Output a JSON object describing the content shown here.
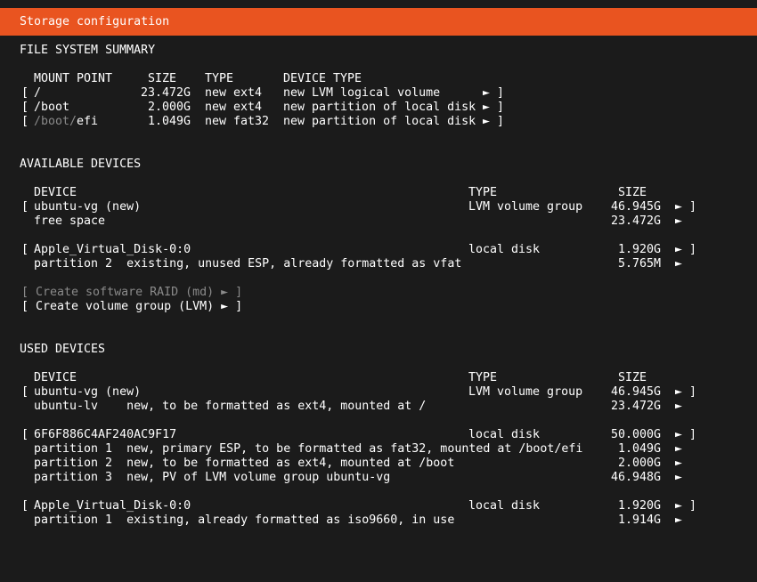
{
  "title": "Storage configuration",
  "fs_summary": {
    "heading": "FILE SYSTEM SUMMARY",
    "headers": {
      "mount": "MOUNT POINT",
      "size": "SIZE",
      "type": "TYPE",
      "devtype": "DEVICE TYPE"
    },
    "rows": [
      {
        "open": "[",
        "mount_dim": "",
        "mount": "/",
        "size": "23.472G",
        "type": "new ext4",
        "devtype": "new LVM logical volume",
        "arrow": "►",
        "close": "]"
      },
      {
        "open": "[",
        "mount_dim": "",
        "mount": "/boot",
        "size": "2.000G",
        "type": "new ext4",
        "devtype": "new partition of local disk",
        "arrow": "►",
        "close": "]"
      },
      {
        "open": "[",
        "mount_dim": "/boot/",
        "mount": "efi",
        "size": "1.049G",
        "type": "new fat32",
        "devtype": "new partition of local disk",
        "arrow": "►",
        "close": "]"
      }
    ]
  },
  "available": {
    "heading": "AVAILABLE DEVICES",
    "headers": {
      "device": "DEVICE",
      "type": "TYPE",
      "size": "SIZE"
    },
    "groups": [
      {
        "open": "[",
        "name": "ubuntu-vg (new)",
        "type": "LVM volume group",
        "size": "46.945G",
        "arrow": "►",
        "close": "]",
        "children": [
          {
            "label": "free space",
            "size": "23.472G",
            "arrow": "►"
          }
        ]
      },
      {
        "open": "[",
        "name": "Apple_Virtual_Disk-0:0",
        "type": "local disk",
        "size": "1.920G",
        "arrow": "►",
        "close": "]",
        "children": [
          {
            "label": "partition 2  existing, unused ESP, already formatted as vfat",
            "size": "5.765M",
            "arrow": "►"
          }
        ]
      }
    ],
    "actions": [
      {
        "label": "[ Create software RAID (md) ► ]",
        "disabled": true
      },
      {
        "label": "[ Create volume group (LVM) ► ]",
        "disabled": false
      }
    ]
  },
  "used": {
    "heading": "USED DEVICES",
    "headers": {
      "device": "DEVICE",
      "type": "TYPE",
      "size": "SIZE"
    },
    "groups": [
      {
        "open": "[",
        "name": "ubuntu-vg (new)",
        "type": "LVM volume group",
        "size": "46.945G",
        "arrow": "►",
        "close": "]",
        "children": [
          {
            "label": "ubuntu-lv    new, to be formatted as ext4, mounted at /",
            "size": "23.472G",
            "arrow": "►"
          }
        ]
      },
      {
        "open": "[",
        "name": "6F6F886C4AF240AC9F17",
        "type": "local disk",
        "size": "50.000G",
        "arrow": "►",
        "close": "]",
        "children": [
          {
            "label": "partition 1  new, primary ESP, to be formatted as fat32, mounted at /boot/efi",
            "size": "1.049G",
            "arrow": "►"
          },
          {
            "label": "partition 2  new, to be formatted as ext4, mounted at /boot",
            "size": "2.000G",
            "arrow": "►"
          },
          {
            "label": "partition 3  new, PV of LVM volume group ubuntu-vg",
            "size": "46.948G",
            "arrow": "►"
          }
        ]
      },
      {
        "open": "[",
        "name": "Apple_Virtual_Disk-0:0",
        "type": "local disk",
        "size": "1.920G",
        "arrow": "►",
        "close": "]",
        "children": [
          {
            "label": "partition 1  existing, already formatted as iso9660, in use",
            "size": "1.914G",
            "arrow": "►"
          }
        ]
      }
    ]
  }
}
